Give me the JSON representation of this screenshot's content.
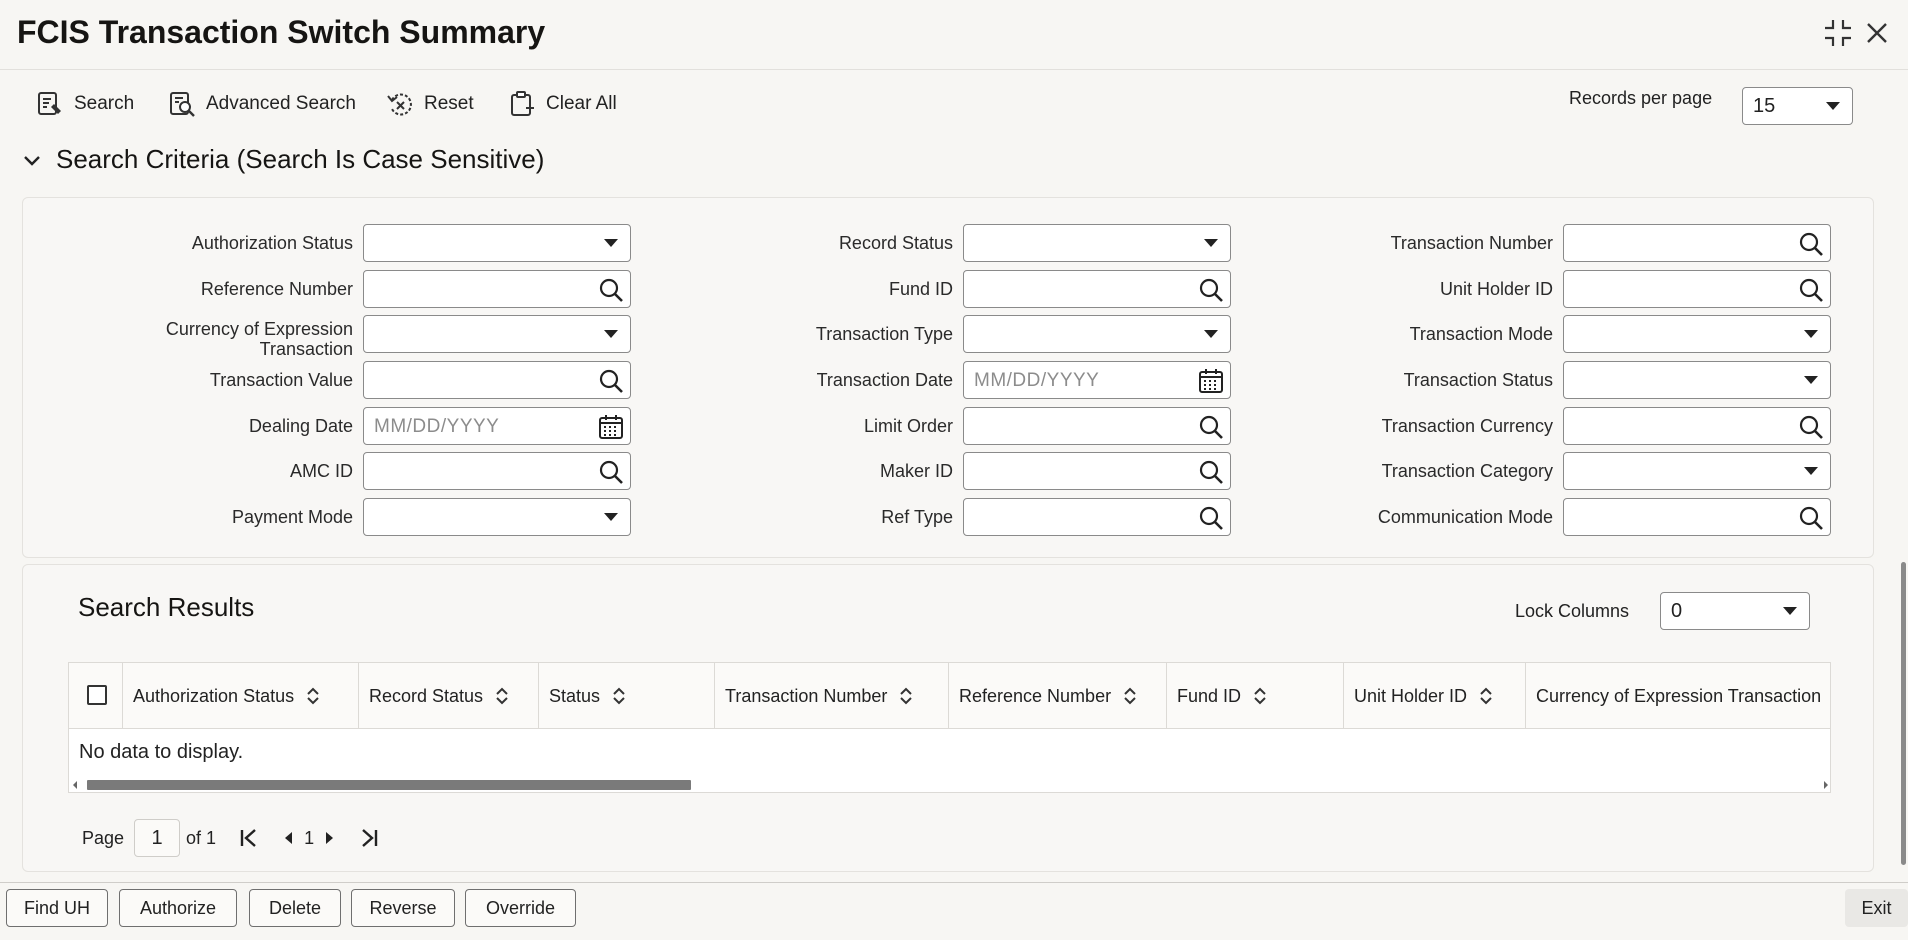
{
  "window": {
    "title": "FCIS Transaction Switch Summary",
    "icons": [
      "compress-icon",
      "close-icon"
    ]
  },
  "toolbar": {
    "search_label": "Search",
    "advanced_search_label": "Advanced Search",
    "reset_label": "Reset",
    "clear_all_label": "Clear All",
    "records_per_page_label": "Records per page",
    "records_per_page_value": "15"
  },
  "criteria": {
    "heading": "Search Criteria (Search Is Case Sensitive)",
    "fields": {
      "authorization_status": {
        "label": "Authorization Status",
        "value": ""
      },
      "record_status": {
        "label": "Record Status",
        "value": ""
      },
      "transaction_number": {
        "label": "Transaction Number",
        "value": ""
      },
      "reference_number": {
        "label": "Reference Number",
        "value": ""
      },
      "fund_id": {
        "label": "Fund ID",
        "value": ""
      },
      "unit_holder_id": {
        "label": "Unit Holder ID",
        "value": ""
      },
      "currency_of_expression_line1": "Currency of Expression",
      "currency_of_expression_line2": "Transaction",
      "transaction_type": {
        "label": "Transaction Type",
        "value": ""
      },
      "transaction_mode": {
        "label": "Transaction Mode",
        "value": ""
      },
      "transaction_value": {
        "label": "Transaction Value",
        "value": ""
      },
      "transaction_date": {
        "label": "Transaction Date",
        "placeholder": "MM/DD/YYYY"
      },
      "transaction_status": {
        "label": "Transaction Status",
        "value": ""
      },
      "dealing_date": {
        "label": "Dealing Date",
        "placeholder": "MM/DD/YYYY"
      },
      "limit_order": {
        "label": "Limit Order",
        "value": ""
      },
      "transaction_currency": {
        "label": "Transaction Currency",
        "value": ""
      },
      "amc_id": {
        "label": "AMC ID",
        "value": ""
      },
      "maker_id": {
        "label": "Maker ID",
        "value": ""
      },
      "transaction_category": {
        "label": "Transaction Category",
        "value": ""
      },
      "payment_mode": {
        "label": "Payment Mode",
        "value": ""
      },
      "ref_type": {
        "label": "Ref Type",
        "value": ""
      },
      "communication_mode": {
        "label": "Communication Mode",
        "value": ""
      }
    }
  },
  "results": {
    "heading": "Search Results",
    "lock_columns_label": "Lock Columns",
    "lock_columns_value": "0",
    "columns": [
      "Authorization Status",
      "Record Status",
      "Status",
      "Transaction Number",
      "Reference Number",
      "Fund ID",
      "Unit Holder ID",
      "Currency of Expression Transaction"
    ],
    "empty_message": "No data to display.",
    "scroll_position": 0.35
  },
  "pager": {
    "page_label": "Page",
    "current_page": "1",
    "of_label": "of 1",
    "page_number": "1"
  },
  "footer": {
    "find_uh": "Find UH",
    "authorize": "Authorize",
    "delete": "Delete",
    "reverse": "Reverse",
    "override": "Override",
    "exit": "Exit"
  }
}
